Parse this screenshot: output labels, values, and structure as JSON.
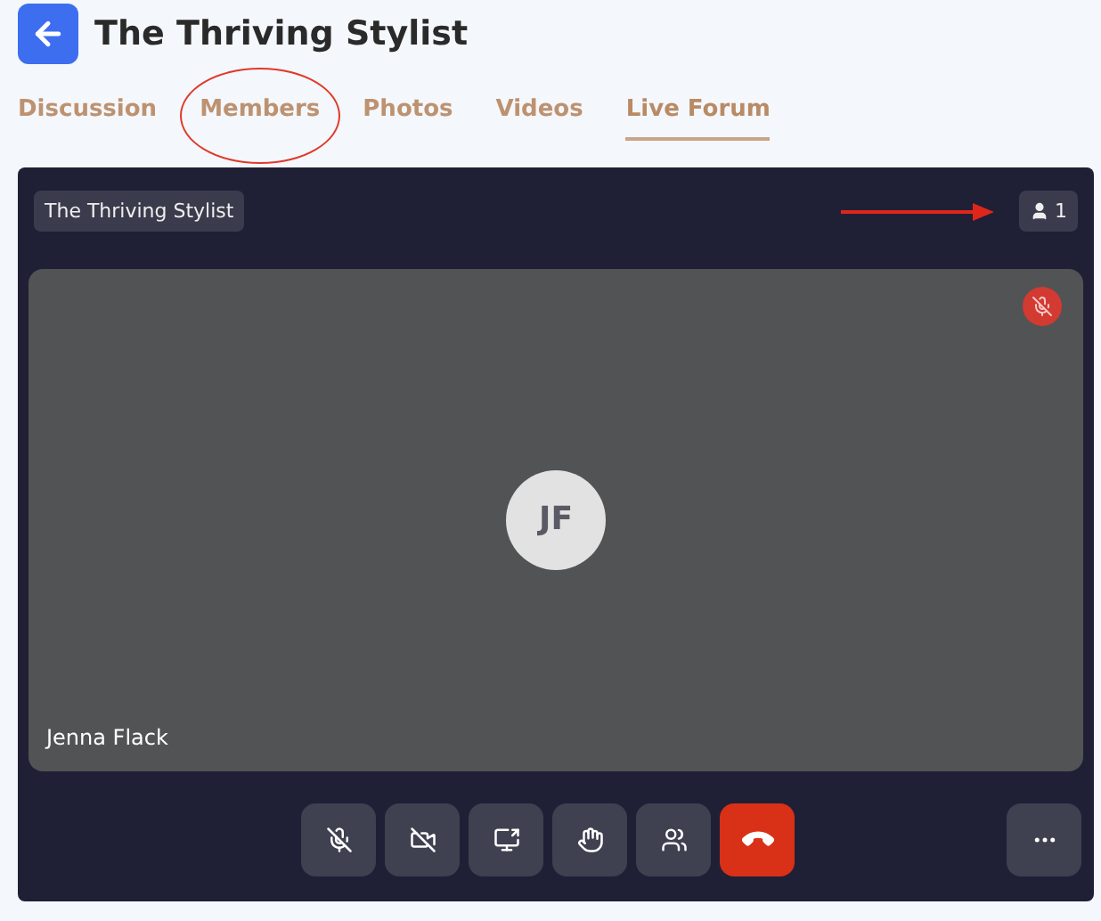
{
  "header": {
    "title": "The Thriving Stylist"
  },
  "tabs": [
    {
      "label": "Discussion",
      "selected": false,
      "circled": false
    },
    {
      "label": "Members",
      "selected": false,
      "circled": true
    },
    {
      "label": "Photos",
      "selected": false,
      "circled": false
    },
    {
      "label": "Videos",
      "selected": false,
      "circled": false
    },
    {
      "label": "Live Forum",
      "selected": true,
      "circled": false
    }
  ],
  "call": {
    "room_name": "The Thriving Stylist",
    "participant_count": "1",
    "count_arrow": true,
    "participant": {
      "initials": "JF",
      "name": "Jenna Flack",
      "muted": true
    },
    "controls": [
      {
        "kind": "mic_off"
      },
      {
        "kind": "video_off"
      },
      {
        "kind": "share"
      },
      {
        "kind": "hand"
      },
      {
        "kind": "people"
      },
      {
        "kind": "hangup"
      },
      {
        "kind": "more"
      }
    ]
  }
}
